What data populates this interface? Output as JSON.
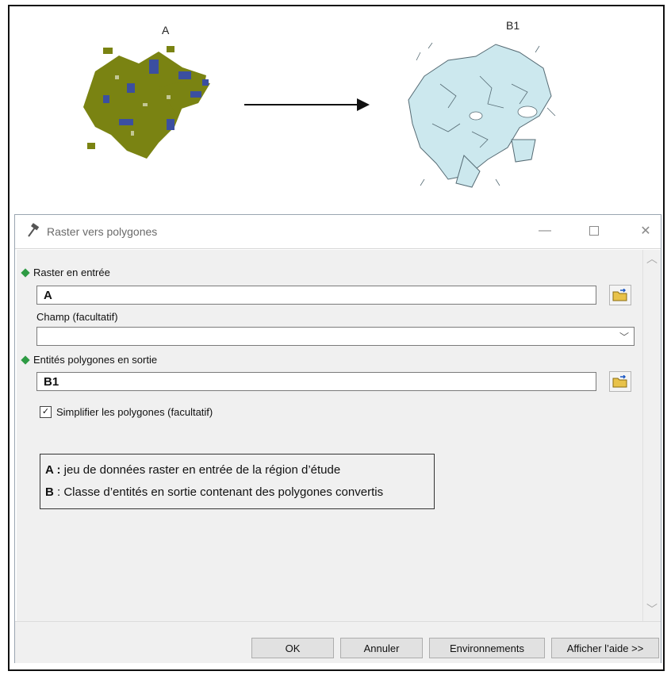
{
  "figure": {
    "label_a": "A",
    "label_b1": "B1"
  },
  "dialog": {
    "title": "Raster vers polygones",
    "minimize_icon": "minimize-icon",
    "maximize_icon": "maximize-icon",
    "close_icon": "close-icon",
    "fields": {
      "raster_input_label": "Raster en entrée",
      "raster_input_value": "A",
      "field_label": "Champ (facultatif)",
      "field_value": "",
      "output_label": "Entités polygones en sortie",
      "output_value": "B1",
      "simplify_label": "Simplifier les polygones (facultatif)",
      "simplify_checked": true
    },
    "legend": {
      "a_key": "A :",
      "a_text": " jeu de données raster en entrée de la région d’étude",
      "b_key": "B",
      "b_text": " : Classe d’entités en sortie contenant des polygones convertis"
    },
    "buttons": {
      "ok": "OK",
      "cancel": "Annuler",
      "env": "Environnements",
      "help": "Afficher l’aide >>"
    }
  },
  "colors": {
    "raster_olive": "#7a8312",
    "raster_blue": "#3b4fa0",
    "polygon_fill": "#cce8ee",
    "polygon_stroke": "#566b74",
    "required_dot": "#2e9b44"
  }
}
